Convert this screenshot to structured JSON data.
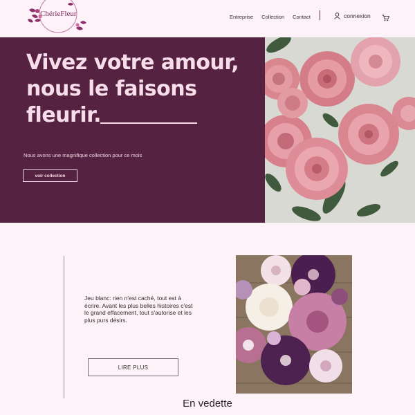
{
  "brand": {
    "name": "ChérieFleur"
  },
  "nav": {
    "links": [
      "Entreprise",
      "Collection",
      "Contact"
    ],
    "login_label": "connexion",
    "icons": [
      "user-icon",
      "cart-icon"
    ]
  },
  "hero": {
    "title_line1": "Vivez votre amour,",
    "title_line2": "nous le faisons",
    "title_line3": "fleurir.",
    "subtitle": "Nous avons une magnifique collection pour ce mois",
    "button_label": "voir collection"
  },
  "feature": {
    "text": "Jeu blanc: rien n'est caché, tout est à écrire. Avant les plus belles histoires c'est le grand effacement, tout s'autorise et les plus purs désirs.",
    "button_label": "LIRE PLUS"
  },
  "section_title": "En vedette",
  "colors": {
    "hero_bg": "#552341",
    "page_bg": "#fcf2f7",
    "accent": "#7b2a58"
  }
}
